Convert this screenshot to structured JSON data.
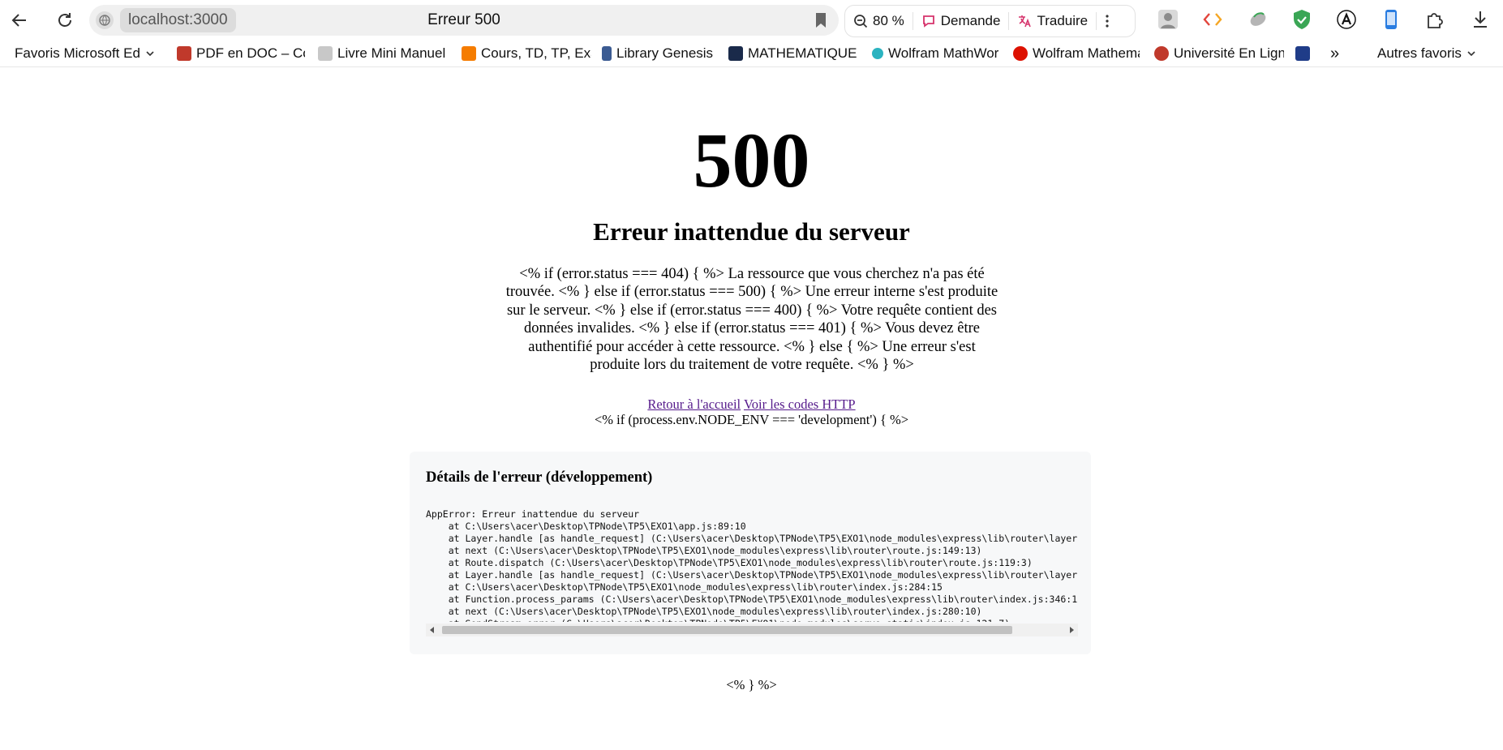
{
  "browser": {
    "url": "localhost:3000",
    "tab_title": "Erreur 500",
    "zoom": "80 %",
    "ask_label": "Demande",
    "translate_label": "Traduire"
  },
  "bookmarks": [
    {
      "label": "Favoris Microsoft Edge",
      "icon": "chevron-down-icon"
    },
    {
      "label": "PDF en DOC – Convertisseur",
      "icon": "pdf-icon",
      "color": "#c0392b"
    },
    {
      "label": "Livre Mini Manuel de",
      "icon": "book-icon",
      "color": "#888888"
    },
    {
      "label": "Cours, TD, TP, Exam",
      "icon": "blogger-icon",
      "color": "#f57c00"
    },
    {
      "label": "Library Genesis",
      "icon": "library-icon",
      "color": "#3b5b92"
    },
    {
      "label": "MATHEMATIQUES",
      "icon": "math-icon",
      "color": "#1a2a4a"
    },
    {
      "label": "Wolfram MathWorld",
      "icon": "mathworld-icon",
      "color": "#2bb3c0"
    },
    {
      "label": "Wolfram Mathematica",
      "icon": "wolfram-icon",
      "color": "#dd1100"
    },
    {
      "label": "Université En Ligne",
      "icon": "uel-icon",
      "color": "#c0392b"
    }
  ],
  "other_favorites": "Autres favoris",
  "page": {
    "code": "500",
    "title": "Erreur inattendue du serveur",
    "message": "<% if (error.status === 404) { %> La ressource que vous cherchez n'a pas été trouvée. <% } else if (error.status === 500) { %> Une erreur interne s'est produite sur le serveur. <% } else if (error.status === 400) { %> Votre requête contient des données invalides. <% } else if (error.status === 401) { %> Vous devez être authentifié pour accéder à cette ressource. <% } else { %> Une erreur s'est produite lors du traitement de votre requête. <% } %>",
    "home_link": "Retour à l'accueil",
    "http_codes_link": "Voir les codes HTTP",
    "env_open": "<% if (process.env.NODE_ENV === 'development') { %>",
    "details_title": "Détails de l'erreur (développement)",
    "stack": "AppError: Erreur inattendue du serveur\n    at C:\\Users\\acer\\Desktop\\TPNode\\TP5\\EXO1\\app.js:89:10\n    at Layer.handle [as handle_request] (C:\\Users\\acer\\Desktop\\TPNode\\TP5\\EXO1\\node_modules\\express\\lib\\router\\layer.js:95:5)\n    at next (C:\\Users\\acer\\Desktop\\TPNode\\TP5\\EXO1\\node_modules\\express\\lib\\router\\route.js:149:13)\n    at Route.dispatch (C:\\Users\\acer\\Desktop\\TPNode\\TP5\\EXO1\\node_modules\\express\\lib\\router\\route.js:119:3)\n    at Layer.handle [as handle_request] (C:\\Users\\acer\\Desktop\\TPNode\\TP5\\EXO1\\node_modules\\express\\lib\\router\\layer.js:95:5)\n    at C:\\Users\\acer\\Desktop\\TPNode\\TP5\\EXO1\\node_modules\\express\\lib\\router\\index.js:284:15\n    at Function.process_params (C:\\Users\\acer\\Desktop\\TPNode\\TP5\\EXO1\\node_modules\\express\\lib\\router\\index.js:346:12)\n    at next (C:\\Users\\acer\\Desktop\\TPNode\\TP5\\EXO1\\node_modules\\express\\lib\\router\\index.js:280:10)\n    at SendStream.error (C:\\Users\\acer\\Desktop\\TPNode\\TP5\\EXO1\\node_modules\\serve-static\\index.js:121:7)\n    at SendStream.emit (node:events:518:28)",
    "env_close": "<% } %>"
  },
  "colors": {
    "link": "#551a8b",
    "details_bg": "#f7f8f9",
    "address_bar_bg": "#f0f0f0",
    "shield_green": "#3aa655",
    "translate_pink": "#d6336c"
  }
}
